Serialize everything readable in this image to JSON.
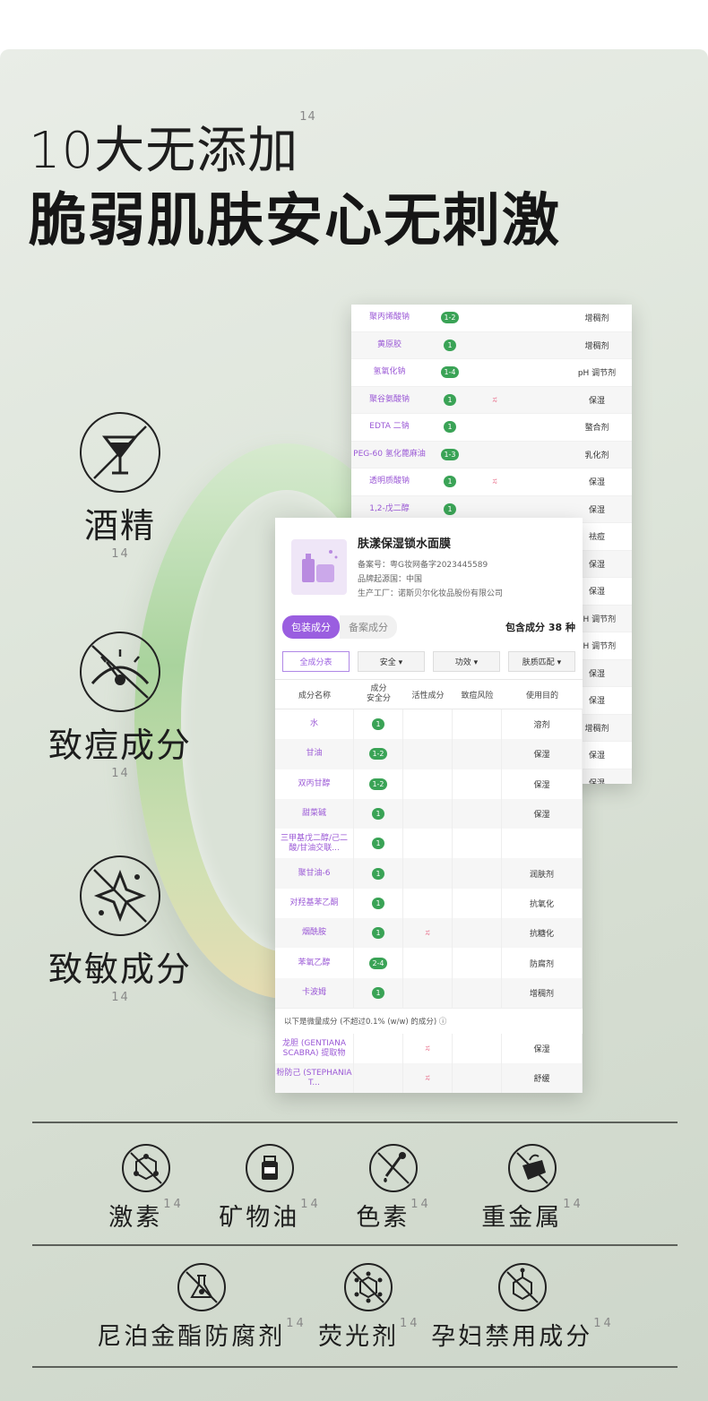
{
  "heading": {
    "line1": "10大无添加",
    "line2": "脆弱肌肤安心无刺激",
    "mark": "14"
  },
  "left_items": [
    {
      "label": "酒精",
      "mark": "14",
      "icon": "martini-glass-icon"
    },
    {
      "label": "致痘成分",
      "mark": "14",
      "icon": "gauge-icon"
    },
    {
      "label": "致敏成分",
      "mark": "14",
      "icon": "sparkle-icon"
    }
  ],
  "back_table": {
    "rows": [
      {
        "name": "聚丙烯酸钠",
        "score": "1-2",
        "active": "",
        "use": "增稠剂"
      },
      {
        "name": "黄原胶",
        "score": "1",
        "active": "",
        "use": "增稠剂"
      },
      {
        "name": "氢氧化钠",
        "score": "1-4",
        "active": "",
        "use": "pH 调节剂"
      },
      {
        "name": "聚谷氨酸钠",
        "score": "1",
        "active": "ಸ",
        "use": "保湿"
      },
      {
        "name": "EDTA 二钠",
        "score": "1",
        "active": "",
        "use": "螯合剂"
      },
      {
        "name": "PEG-60 氢化蓖麻油",
        "score": "1-3",
        "active": "",
        "use": "乳化剂"
      },
      {
        "name": "透明质酸钠",
        "score": "1",
        "active": "ಸ",
        "use": "保湿"
      },
      {
        "name": "1,2-戊二醇",
        "score": "1",
        "active": "",
        "use": "保湿"
      },
      {
        "name": "",
        "score": "",
        "active": "",
        "use": "祛痘"
      },
      {
        "name": "",
        "score": "",
        "active": "",
        "use": "保湿"
      },
      {
        "name": "",
        "score": "",
        "active": "",
        "use": "保湿"
      },
      {
        "name": "",
        "score": "",
        "active": "",
        "use": "pH 调节剂"
      },
      {
        "name": "",
        "score": "",
        "active": "",
        "use": "pH 调节剂"
      },
      {
        "name": "",
        "score": "",
        "active": "",
        "use": "保湿"
      },
      {
        "name": "",
        "score": "",
        "active": "",
        "use": "保湿"
      },
      {
        "name": "",
        "score": "",
        "active": "",
        "use": "增稠剂"
      },
      {
        "name": "",
        "score": "",
        "active": "",
        "use": "保湿"
      },
      {
        "name": "",
        "score": "",
        "active": "",
        "use": "保湿"
      }
    ]
  },
  "product": {
    "title": "肤漾保湿锁水面膜",
    "record": "备案号：粤G妆网备字2023445589",
    "origin": "品牌起源国：中国",
    "factory": "生产工厂：诺斯贝尔化妆品股份有限公司",
    "tab_active": "包装成分",
    "tab_inactive": "备案成分",
    "count": "包含成分 38 种",
    "filters": [
      "全成分表",
      "安全 ▾",
      "功效 ▾",
      "肤质匹配 ▾"
    ],
    "columns": [
      "成分名称",
      "成分\n安全分",
      "活性成分",
      "致痘风险",
      "使用目的"
    ],
    "rows": [
      {
        "name": "水",
        "score": "1",
        "active": "",
        "use": "溶剂"
      },
      {
        "name": "甘油",
        "score": "1-2",
        "active": "",
        "use": "保湿"
      },
      {
        "name": "双丙甘醇",
        "score": "1-2",
        "active": "",
        "use": "保湿"
      },
      {
        "name": "甜菜碱",
        "score": "1",
        "active": "",
        "use": "保湿"
      },
      {
        "name": "三甲基戊二醇/己二酸/甘油交联...",
        "score": "1",
        "active": "",
        "use": ""
      },
      {
        "name": "聚甘油-6",
        "score": "1",
        "active": "",
        "use": "润肤剂"
      },
      {
        "name": "对羟基苯乙酮",
        "score": "1",
        "active": "",
        "use": "抗氧化"
      },
      {
        "name": "烟酰胺",
        "score": "1",
        "active": "ಸ",
        "use": "抗糖化"
      },
      {
        "name": "苯氧乙醇",
        "score": "2-4",
        "active": "",
        "use": "防腐剂"
      },
      {
        "name": "卡波姆",
        "score": "1",
        "active": "",
        "use": "增稠剂"
      }
    ],
    "micro_note": "以下是微量成分 (不超过0.1% (w/w) 的成分) ⓘ",
    "micro_rows": [
      {
        "name": "龙胆 (GENTIANA SCABRA) 提取物",
        "active": "ಸ",
        "use": "保湿"
      },
      {
        "name": "粉防己 (STEPHANIA T...",
        "active": "ಸ",
        "use": "舒缓"
      }
    ]
  },
  "bottom_row1": [
    {
      "label": "激素",
      "mark": "14",
      "icon": "molecule-icon"
    },
    {
      "label": "矿物油",
      "mark": "14",
      "icon": "oil-bottle-icon"
    },
    {
      "label": "色素",
      "mark": "14",
      "icon": "dropper-icon"
    },
    {
      "label": "重金属",
      "mark": "14",
      "icon": "metal-bucket-icon"
    }
  ],
  "bottom_row2": [
    {
      "label": "尼泊金酯防腐剂",
      "mark": "14",
      "icon": "flask-icon"
    },
    {
      "label": "荧光剂",
      "mark": "14",
      "icon": "fluorescent-icon"
    },
    {
      "label": "孕妇禁用成分",
      "mark": "14",
      "icon": "hexagon-structure-icon"
    }
  ]
}
